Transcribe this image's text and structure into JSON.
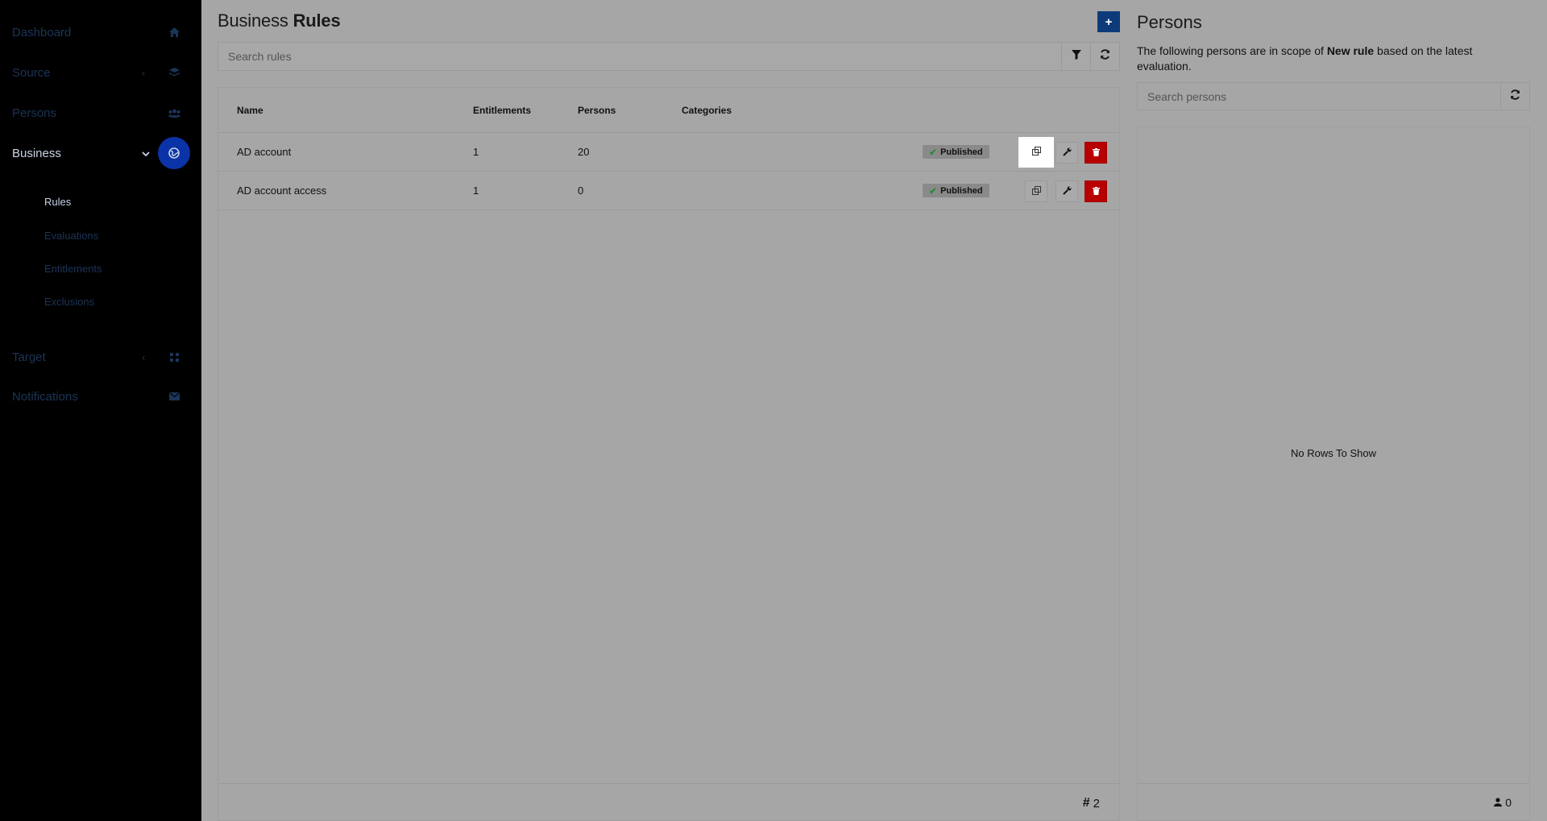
{
  "sidebar": {
    "items": [
      {
        "label": "Dashboard",
        "icon": "home-icon"
      },
      {
        "label": "Source",
        "icon": "layers-icon"
      },
      {
        "label": "Persons",
        "icon": "users-icon"
      },
      {
        "label": "Business",
        "icon": "globe-icon"
      },
      {
        "label": "Target",
        "icon": "grid-icon"
      },
      {
        "label": "Notifications",
        "icon": "envelope-icon"
      }
    ],
    "business_sub": [
      "Rules",
      "Evaluations",
      "Entitlements",
      "Exclusions"
    ]
  },
  "main": {
    "title_light": "Business",
    "title_bold": "Rules",
    "add_label": "+",
    "search_placeholder": "Search rules",
    "columns": [
      "Name",
      "Entitlements",
      "Persons",
      "Categories"
    ],
    "rows": [
      {
        "name": "AD account",
        "entitlements": "1",
        "persons": "20",
        "categories": "",
        "status": "Published"
      },
      {
        "name": "AD account access",
        "entitlements": "1",
        "persons": "0",
        "categories": "",
        "status": "Published"
      }
    ],
    "count": "2"
  },
  "persons_panel": {
    "title": "Persons",
    "desc_pre": "The following persons are in scope of ",
    "desc_rule": "New rule",
    "desc_post": " based on the latest evaluation.",
    "search_placeholder": "Search persons",
    "empty_text": "No Rows To Show",
    "count": "0"
  },
  "colors": {
    "sidebar_bg": "#000000",
    "active_circle": "#0b33a8",
    "add_button": "#0d3b7a",
    "delete_button": "#b80000",
    "overlay_bg": "#a6a6a6"
  }
}
